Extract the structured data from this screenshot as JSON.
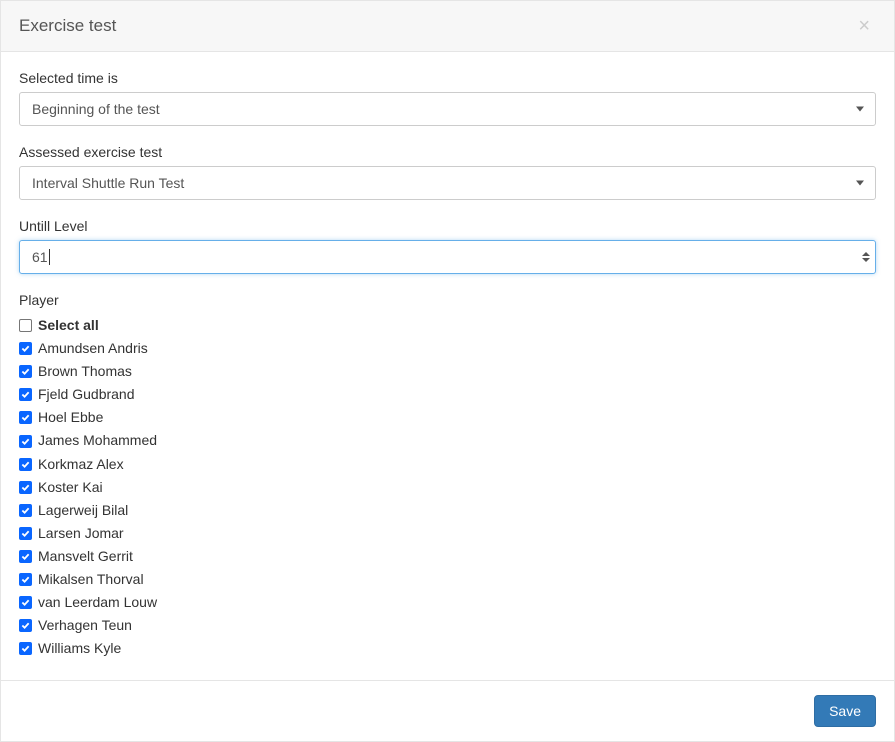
{
  "header": {
    "title": "Exercise test",
    "close_icon": "×"
  },
  "form": {
    "selected_time": {
      "label": "Selected time is",
      "value": "Beginning of the test"
    },
    "assessed_test": {
      "label": "Assessed exercise test",
      "value": "Interval Shuttle Run Test"
    },
    "untill_level": {
      "label": "Untill Level",
      "value": "61"
    }
  },
  "player_section": {
    "label": "Player",
    "select_all": {
      "label": "Select all",
      "checked": false
    },
    "players": [
      {
        "name": "Amundsen Andris",
        "checked": true
      },
      {
        "name": "Brown Thomas",
        "checked": true
      },
      {
        "name": "Fjeld Gudbrand",
        "checked": true
      },
      {
        "name": "Hoel Ebbe",
        "checked": true
      },
      {
        "name": "James Mohammed",
        "checked": true
      },
      {
        "name": "Korkmaz Alex",
        "checked": true
      },
      {
        "name": "Koster Kai",
        "checked": true
      },
      {
        "name": "Lagerweij Bilal",
        "checked": true
      },
      {
        "name": "Larsen Jomar",
        "checked": true
      },
      {
        "name": "Mansvelt Gerrit",
        "checked": true
      },
      {
        "name": "Mikalsen Thorval",
        "checked": true
      },
      {
        "name": "van Leerdam Louw",
        "checked": true
      },
      {
        "name": "Verhagen Teun",
        "checked": true
      },
      {
        "name": "Williams Kyle",
        "checked": true
      }
    ]
  },
  "footer": {
    "save_label": "Save"
  },
  "colors": {
    "checkbox_checked": "#0a66ff",
    "primary_button": "#337ab7",
    "focus_border": "#66afe9"
  }
}
